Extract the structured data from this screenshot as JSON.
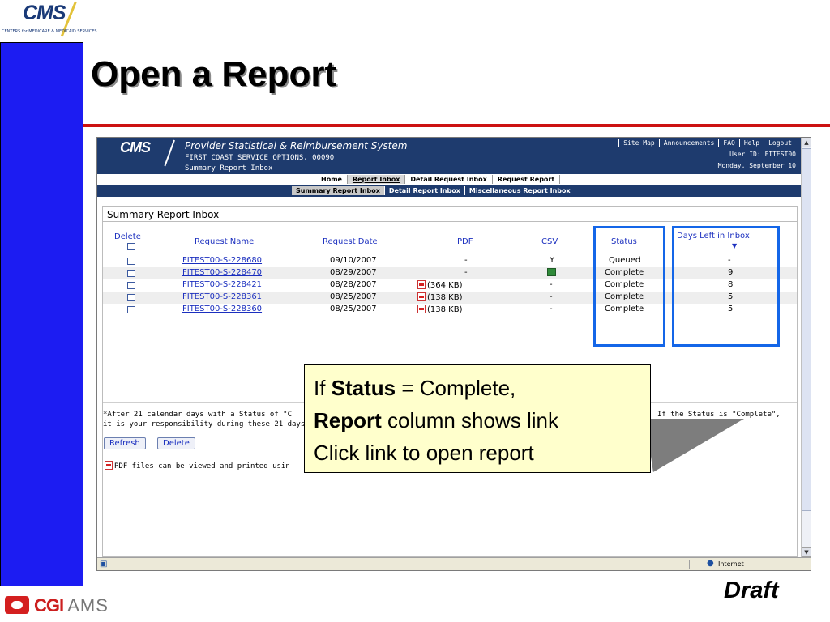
{
  "slide": {
    "title": "Open a Report",
    "footer_mark": "Draft",
    "cms_logo_text": "CMS",
    "cms_logo_subtext": "CENTERS for MEDICARE & MEDICAID SERVICES",
    "cgi_logo_text": "CGI",
    "ams_logo_text": "AMS"
  },
  "app": {
    "logo_text": "CMS",
    "system_name": "Provider Statistical & Reimbursement System",
    "org_line": "FIRST COAST SERVICE OPTIONS, 00090",
    "page_label": "Summary Report Inbox",
    "top_links": [
      "Site Map",
      "Announcements",
      "FAQ",
      "Help",
      "Logout"
    ],
    "user_id": "User ID: FITEST00",
    "date": "Monday, September 10",
    "main_tabs": [
      {
        "label": "Home",
        "active": false
      },
      {
        "label": "Report Inbox",
        "active": true
      },
      {
        "label": "Detail Request Inbox",
        "active": false
      },
      {
        "label": "Request Report",
        "active": false
      }
    ],
    "sub_tabs": [
      {
        "label": "Summary Report Inbox",
        "active": true
      },
      {
        "label": "Detail Report Inbox",
        "active": false
      },
      {
        "label": "Miscellaneous Report Inbox",
        "active": false
      }
    ]
  },
  "inbox": {
    "title": "Summary Report Inbox",
    "columns": {
      "delete": "Delete",
      "request_name": "Request Name",
      "request_date": "Request Date",
      "pdf": "PDF",
      "csv": "CSV",
      "status": "Status",
      "days_left": "Days Left in Inbox"
    },
    "rows": [
      {
        "name": "FITEST00-S-228680",
        "date": "09/10/2007",
        "pdf": "-",
        "csv": "Y",
        "status": "Queued",
        "days": "-"
      },
      {
        "name": "FITEST00-S-228470",
        "date": "08/29/2007",
        "pdf": "-",
        "csv": "",
        "status": "Complete",
        "days": "9"
      },
      {
        "name": "FITEST00-S-228421",
        "date": "08/28/2007",
        "pdf": "(364 KB)",
        "csv": "-",
        "status": "Complete",
        "days": "8"
      },
      {
        "name": "FITEST00-S-228361",
        "date": "08/25/2007",
        "pdf": "(138 KB)",
        "csv": "-",
        "status": "Complete",
        "days": "5"
      },
      {
        "name": "FITEST00-S-228360",
        "date": "08/25/2007",
        "pdf": "(138 KB)",
        "csv": "-",
        "status": "Complete",
        "days": "5"
      }
    ],
    "footnote_line1": "*After 21 calendar days with a Status of \"C",
    "footnote_line1_right": "If  the Status is \"Complete\",",
    "footnote_line2": "it is your responsibility during these 21 days",
    "refresh_label": "Refresh",
    "delete_label": "Delete",
    "pdf_note": "PDF files can be viewed and printed usin"
  },
  "browser_status": {
    "zone": "Internet"
  },
  "callout": {
    "line1_prefix": "If ",
    "line1_bold": "Status",
    "line1_suffix": " = Complete,",
    "line2_bold": "Report",
    "line2_suffix": " column shows link",
    "line3": "Click link to open report"
  }
}
